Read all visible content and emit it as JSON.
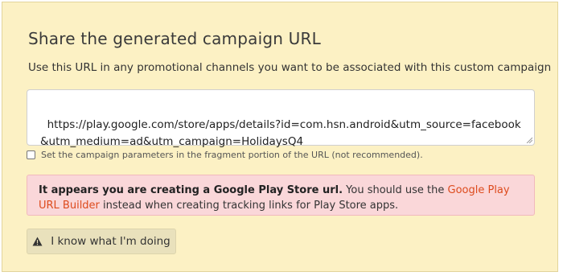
{
  "panel": {
    "title": "Share the generated campaign URL",
    "subtitle": "Use this URL in any promotional channels you want to be associated with this custom campaign",
    "generated_url": "https://play.google.com/store/apps/details?id=com.hsn.android&utm_source=facebook&utm_medium=ad&utm_campaign=HolidaysQ4",
    "fragment_checkbox": {
      "label": "Set the campaign parameters in the fragment portion of the URL (not recommended).",
      "checked": false
    },
    "alert": {
      "bold_text": "It appears you are creating a Google Play Store url.",
      "text_before_link": " You should use the ",
      "link_text": "Google Play URL Builder",
      "text_after_link": " instead when creating tracking links for Play Store apps."
    },
    "confirm_button": {
      "label": "I know what I'm doing",
      "icon": "warning-icon"
    }
  },
  "colors": {
    "panel_background": "#fcf1c4",
    "alert_background": "#fad7d9",
    "link": "#dd4b1d",
    "button_background": "#e9e1bc"
  }
}
